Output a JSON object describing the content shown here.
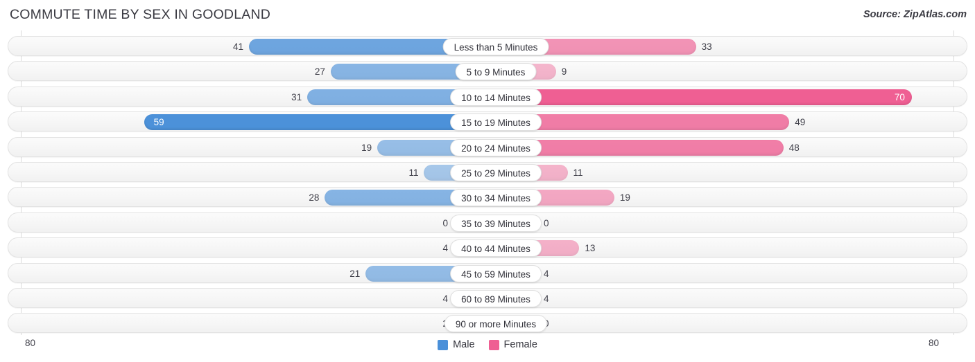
{
  "header": {
    "title": "COMMUTE TIME BY SEX IN GOODLAND",
    "source": "Source: ZipAtlas.com"
  },
  "axis": {
    "left_end": "80",
    "right_end": "80",
    "max": 80
  },
  "legend": {
    "items": [
      {
        "label": "Male",
        "color": "#4a90d9",
        "icon": "square-swatch"
      },
      {
        "label": "Female",
        "color": "#ef5f93",
        "icon": "square-swatch"
      }
    ]
  },
  "colors": {
    "male": "#4a90d9",
    "female": "#ef5f93",
    "track": "#f6f6f6",
    "track_border": "#e2e2e2",
    "gridline": "#d8d8d8",
    "text": "#3c3c42"
  },
  "chart_data": {
    "type": "bar",
    "subtype": "diverging-bar",
    "title": "COMMUTE TIME BY SEX IN GOODLAND",
    "source": "Source: ZipAtlas.com",
    "xlabel": "",
    "ylabel": "",
    "xlim": [
      80,
      80
    ],
    "axis_max": 80,
    "grid": true,
    "legend_position": "bottom-center",
    "categories": [
      "Less than 5 Minutes",
      "5 to 9 Minutes",
      "10 to 14 Minutes",
      "15 to 19 Minutes",
      "20 to 24 Minutes",
      "25 to 29 Minutes",
      "30 to 34 Minutes",
      "35 to 39 Minutes",
      "40 to 44 Minutes",
      "45 to 59 Minutes",
      "60 to 89 Minutes",
      "90 or more Minutes"
    ],
    "series": [
      {
        "name": "Male",
        "direction": "left",
        "color": "#4a90d9",
        "values": [
          41,
          27,
          31,
          59,
          19,
          11,
          28,
          0,
          4,
          21,
          4,
          2
        ]
      },
      {
        "name": "Female",
        "direction": "right",
        "color": "#ef5f93",
        "values": [
          33,
          9,
          70,
          49,
          48,
          11,
          19,
          0,
          13,
          4,
          4,
          0
        ]
      }
    ]
  }
}
